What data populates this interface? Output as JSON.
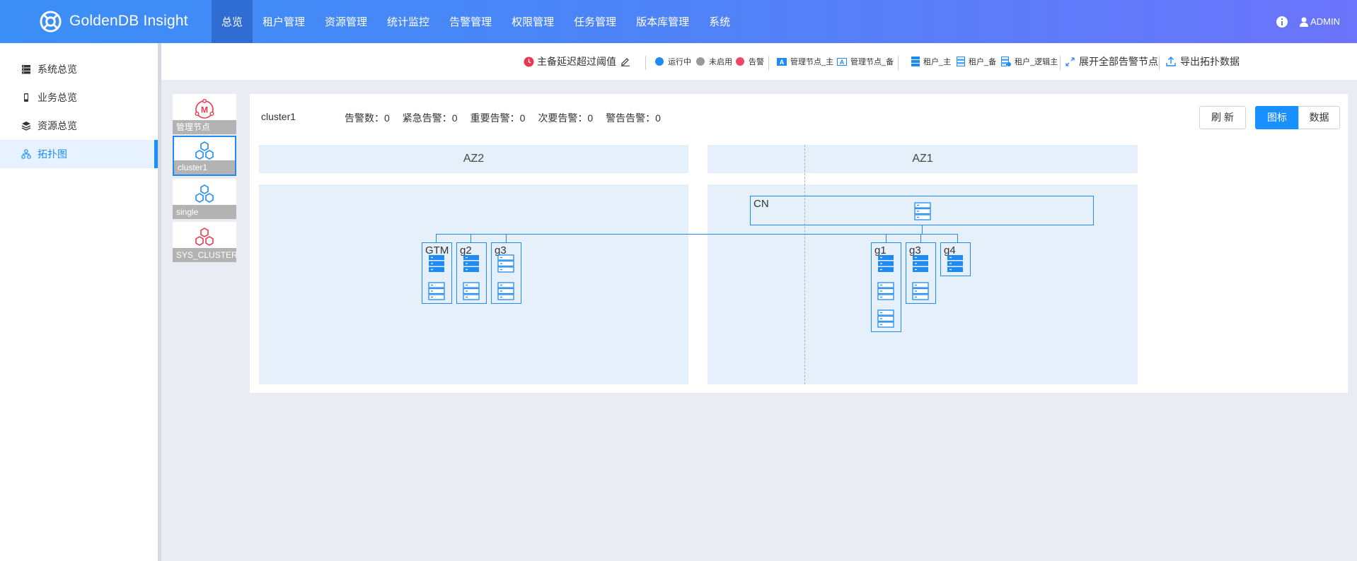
{
  "brand": {
    "name": "GoldenDB Insight"
  },
  "nav": {
    "items": [
      {
        "label": "总览",
        "active": true
      },
      {
        "label": "租户管理"
      },
      {
        "label": "资源管理"
      },
      {
        "label": "统计监控"
      },
      {
        "label": "告警管理"
      },
      {
        "label": "权限管理"
      },
      {
        "label": "任务管理"
      },
      {
        "label": "版本库管理"
      },
      {
        "label": "系统"
      }
    ]
  },
  "user": {
    "name": "ADMIN"
  },
  "sidebar": {
    "items": [
      {
        "label": "系统总览",
        "icon": "server-list-icon"
      },
      {
        "label": "业务总览",
        "icon": "phone-icon"
      },
      {
        "label": "资源总览",
        "icon": "layers-icon"
      },
      {
        "label": "拓扑图",
        "icon": "topology-icon",
        "active": true
      }
    ]
  },
  "toolbar": {
    "delay_threshold": "主备延迟超过阈值",
    "legend_running": "运行中",
    "legend_disabled": "未启用",
    "legend_alarm": "告警",
    "legend_mgmt_master": "管理节点_主",
    "legend_mgmt_backup": "管理节点_备",
    "legend_tenant_master": "租户_主",
    "legend_tenant_backup": "租户_备",
    "legend_tenant_logic": "租户_逻辑主",
    "expand_alarms": "展开全部告警节点",
    "export": "导出拓扑数据"
  },
  "clusters": [
    {
      "label": "管理节点",
      "icon": "management-node-icon"
    },
    {
      "label": "cluster1",
      "icon": "cluster-icon",
      "active": true
    },
    {
      "label": "single",
      "icon": "cluster-icon"
    },
    {
      "label": "SYS_CLUSTER",
      "icon": "cluster-alarm-icon"
    }
  ],
  "panel": {
    "cluster_name": "cluster1",
    "stats": {
      "total": "告警数：0",
      "urgent": "紧急告警：0",
      "important": "重要告警：0",
      "secondary": "次要告警：0",
      "warning": "警告告警：0"
    },
    "refresh_label": "刷 新",
    "view_icon_label": "图标",
    "view_data_label": "数据"
  },
  "topology": {
    "az_left": "AZ2",
    "az_right": "AZ1",
    "cn_label": "CN",
    "left_nodes": [
      "GTM",
      "g2",
      "g3"
    ],
    "right_nodes": [
      "g1",
      "g3",
      "g4"
    ]
  },
  "colors": {
    "accent": "#1890ff",
    "running": "#1f8bf2",
    "disabled": "#9a9a9a",
    "alarm": "#ee4866"
  }
}
